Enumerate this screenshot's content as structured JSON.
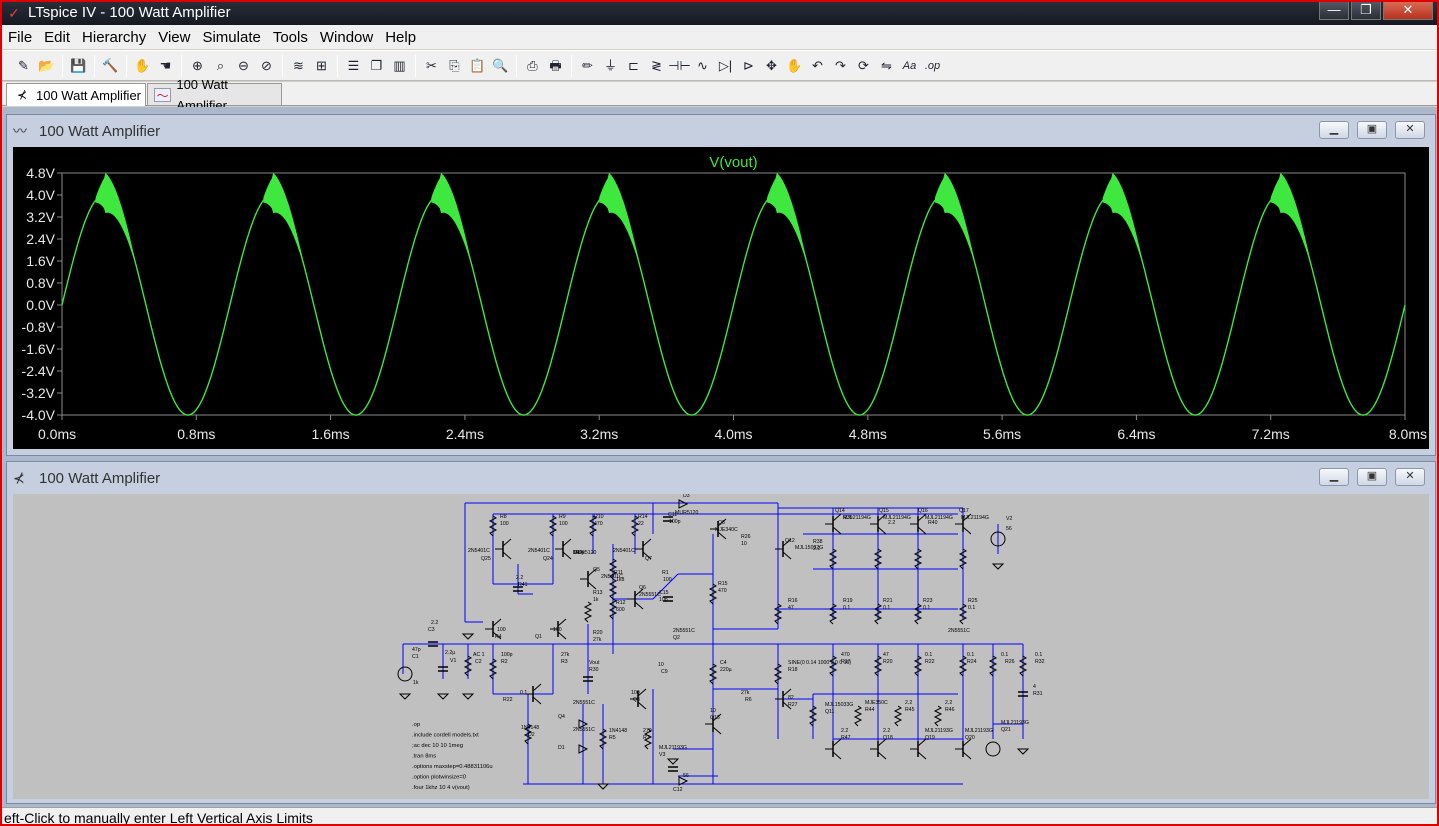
{
  "window": {
    "title": "LTspice IV - 100 Watt Amplifier",
    "minimize_glyph": "—",
    "restore_glyph": "❐",
    "close_glyph": "✕"
  },
  "menu": [
    "File",
    "Edit",
    "Hierarchy",
    "View",
    "Simulate",
    "Tools",
    "Window",
    "Help"
  ],
  "toolbar": {
    "icons": [
      "run-icon",
      "open-icon",
      "|",
      "save-icon",
      "|",
      "control-panel-icon",
      "|",
      "halt-icon",
      "pan-icon",
      "|",
      "zoom-in-icon",
      "zoom-fit-icon",
      "zoom-out-icon",
      "zoom-cancel-icon",
      "|",
      "autorange-icon",
      "mark-unused-icon",
      "|",
      "tile-horizontal-icon",
      "cascade-icon",
      "tile-vertical-icon",
      "|",
      "cut-icon",
      "copy-icon",
      "paste-icon",
      "find-icon",
      "|",
      "print-icon",
      "print-preview-icon",
      "|",
      "wire-icon",
      "ground-icon",
      "label-net-icon",
      "resistor-icon",
      "capacitor-icon",
      "inductor-icon",
      "diode-icon",
      "component-icon",
      "move-icon",
      "drag-icon",
      "undo-icon",
      "redo-icon",
      "rotate-icon",
      "mirror-icon",
      "text-icon",
      "spice-directive-icon"
    ]
  },
  "tabs": [
    {
      "label": "100 Watt Amplifier",
      "kind": "schematic",
      "active": true
    },
    {
      "label": "100 Watt Amplifier",
      "kind": "waveform",
      "active": false
    }
  ],
  "waveform_window": {
    "title": "100 Watt Amplifier",
    "trace_color": "#3ee83e"
  },
  "schematic_window": {
    "title": "100 Watt Amplifier",
    "wire_color": "#0000ff",
    "labels": [
      "D3",
      "MUR5120",
      "C11",
      "100p",
      "Q8",
      "MJE340C",
      "R26",
      "10",
      "Q12",
      "MJL15032G",
      "R38",
      "2.2",
      "Q14",
      "MJL21194G",
      "Q15",
      "MJL21194G",
      "Q16",
      "MJL21194G",
      "Q17",
      "MJL21194G",
      "V2",
      "56",
      "R8",
      "100",
      "R9",
      "100",
      "R10",
      "470",
      "R14",
      "22",
      "2N5401C",
      "Q25",
      "2N5401C",
      "Q24",
      "2N5401C",
      "Q7",
      "R11",
      "1k8",
      "R13",
      "1k",
      "R12",
      "600",
      "R1",
      "100",
      "C15",
      "10p",
      "Q5",
      "2N5401C",
      "Q6",
      "2N5551C",
      "R15",
      "470",
      "R16",
      "47",
      "R19",
      "0.1",
      "R21",
      "0.1",
      "R23",
      "0.1",
      "R25",
      "0.1",
      "R39",
      "2.2",
      "R40",
      "2.2",
      "R41",
      "2.2",
      "C3",
      "47p",
      "C1",
      "2.2µ",
      "V1",
      "AC 1",
      "C2",
      "100p",
      "R2",
      "27k",
      "R3",
      "100",
      "R4",
      "100",
      "Q1",
      "2N5551C",
      "Q2",
      "2N5551C",
      "R20",
      "27k",
      "Vout",
      "R30",
      "1k",
      "C4",
      "220µ",
      "SINE(0 0.14 1000 0 0 0 16)",
      "R18",
      "470",
      "R17",
      "47",
      "R20",
      "0.1",
      "R22",
      "0.1",
      "R24",
      "0.1",
      "R26",
      "0.1",
      "R32",
      "4",
      "R31",
      "10",
      "C9",
      "0.1",
      "R22",
      "100",
      "Q3",
      "2N5551C",
      "Q4",
      "2N5551C",
      "D1",
      "1N4148",
      "D2",
      "1N4148",
      "R5",
      "270",
      "R7",
      "27k",
      "R6",
      "82",
      "R27",
      "10",
      "Q13",
      "MJL15033G",
      "Q11",
      "MJE350C",
      "R44",
      "2.2",
      "R45",
      "2.2",
      "R46",
      "2.2",
      "R47",
      "2.2",
      "Q18",
      "MJL21193G",
      "Q19",
      "MJL21193G",
      "Q20",
      "MJL21193G",
      "Q21",
      "MJL21193G",
      "V3",
      "56",
      "C12",
      "100p",
      "D4",
      "MUR5120"
    ],
    "directives": [
      ".op",
      ".include cordell models.txt",
      ";ac dec 10 10 1meg",
      ".tran 8ms",
      ".options maxstep=0.48831106u",
      ".option plotwinsize=0",
      ".four 1khz 10 4 v(vout)"
    ]
  },
  "status": {
    "text": "eft-Click to manually enter Left Vertical Axis Limits"
  },
  "chart_data": {
    "type": "line",
    "title": "V(vout)",
    "xlabel": "",
    "ylabel": "",
    "x_ticks": [
      "0.0ms",
      "0.8ms",
      "1.6ms",
      "2.4ms",
      "3.2ms",
      "4.0ms",
      "4.8ms",
      "5.6ms",
      "6.4ms",
      "7.2ms",
      "8.0ms"
    ],
    "y_ticks": [
      "4.8V",
      "4.0V",
      "3.2V",
      "2.4V",
      "1.6V",
      "0.8V",
      "0.0V",
      "-0.8V",
      "-1.6V",
      "-2.4V",
      "-3.2V",
      "-4.0V"
    ],
    "xlim": [
      0,
      8.0
    ],
    "ylim": [
      -4.0,
      4.8
    ],
    "grid": false,
    "x_unit": "ms",
    "y_unit": "V",
    "series": [
      {
        "name": "V(vout)",
        "signal": "sine",
        "frequency_khz": 1,
        "cycles": 8,
        "amplitude_v": 4.0,
        "offset_v": 0.0,
        "positive_peak_v": 4.5,
        "negative_peak_v": -4.0,
        "x": [
          0,
          0.25,
          0.5,
          0.75,
          1.0,
          1.25,
          1.5,
          1.75,
          2.0,
          2.25,
          2.5,
          2.75,
          3.0,
          3.25,
          3.5,
          3.75,
          4.0,
          4.25,
          4.5,
          4.75,
          5.0,
          5.25,
          5.5,
          5.75,
          6.0,
          6.25,
          6.5,
          6.75,
          7.0,
          7.25,
          7.5,
          7.75,
          8.0
        ],
        "y": [
          0.0,
          4.5,
          0.0,
          -4.0,
          0.0,
          4.5,
          0.0,
          -4.0,
          0.0,
          4.5,
          0.0,
          -4.0,
          0.0,
          4.5,
          0.0,
          -4.0,
          0.0,
          4.5,
          0.0,
          -4.0,
          0.0,
          4.5,
          0.0,
          -4.0,
          0.0,
          4.5,
          0.0,
          -4.0,
          0.0,
          4.5,
          0.0,
          -4.0,
          0.0
        ]
      }
    ]
  }
}
